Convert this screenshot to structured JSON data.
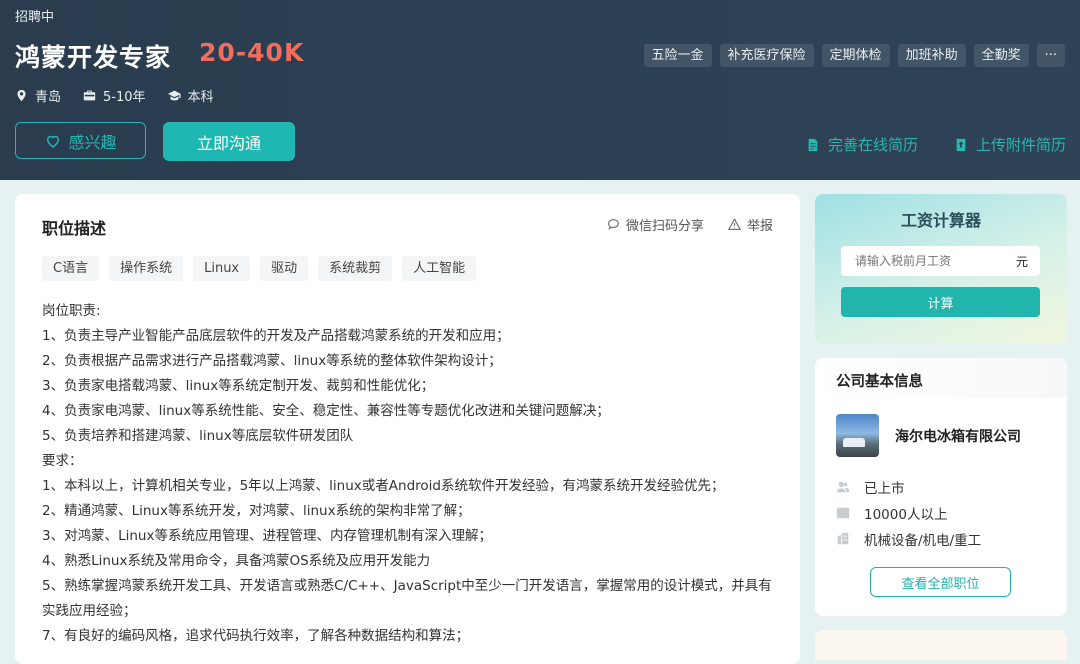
{
  "header": {
    "status": "招聘中",
    "title": "鸿蒙开发专家",
    "salary": "20-40K",
    "meta": {
      "city": "青岛",
      "experience": "5-10年",
      "education": "本科"
    },
    "benefits": [
      "五险一金",
      "补充医疗保险",
      "定期体检",
      "加班补助",
      "全勤奖",
      "···"
    ],
    "interest_label": "感兴趣",
    "chat_label": "立即沟通",
    "resume_online": "完善在线简历",
    "resume_upload": "上传附件简历"
  },
  "job": {
    "section_title": "职位描述",
    "share_label": "微信扫码分享",
    "report_label": "举报",
    "tags": [
      "C语言",
      "操作系统",
      "Linux",
      "驱动",
      "系统裁剪",
      "人工智能"
    ],
    "description": [
      "岗位职责:",
      "1、负责主导产业智能产品底层软件的开发及产品搭载鸿蒙系统的开发和应用；",
      "2、负责根据产品需求进行产品搭载鸿蒙、linux等系统的整体软件架构设计；",
      "3、负责家电搭载鸿蒙、linux等系统定制开发、裁剪和性能优化；",
      "4、负责家电鸿蒙、linux等系统性能、安全、稳定性、兼容性等专题优化改进和关键问题解决；",
      "5、负责培养和搭建鸿蒙、linux等底层软件研发团队",
      "要求：",
      "1、本科以上，计算机相关专业，5年以上鸿蒙、linux或者Android系统软件开发经验，有鸿蒙系统开发经验优先；",
      "2、精通鸿蒙、Linux等系统开发，对鸿蒙、linux系统的架构非常了解；",
      "3、对鸿蒙、Linux等系统应用管理、进程管理、内存管理机制有深入理解；",
      "4、熟悉Linux系统及常用命令，具备鸿蒙OS系统及应用开发能力",
      "5、熟练掌握鸿蒙系统开发工具、开发语言或熟悉C/C++、JavaScript中至少一门开发语言，掌握常用的设计模式，并具有实践应用经验；",
      "7、有良好的编码风格，追求代码执行效率，了解各种数据结构和算法；"
    ]
  },
  "calculator": {
    "title": "工资计算器",
    "placeholder": "请输入税前月工资",
    "unit": "元",
    "button": "计算"
  },
  "company": {
    "section_title": "公司基本信息",
    "name": "海尔电冰箱有限公司",
    "stage": "已上市",
    "size": "10000人以上",
    "industry": "机械设备/机电/重工",
    "view_all": "查看全部职位"
  },
  "colors": {
    "header_bg": "#2c3e50",
    "accent": "#1fb7b1",
    "salary": "#f26d5b"
  }
}
